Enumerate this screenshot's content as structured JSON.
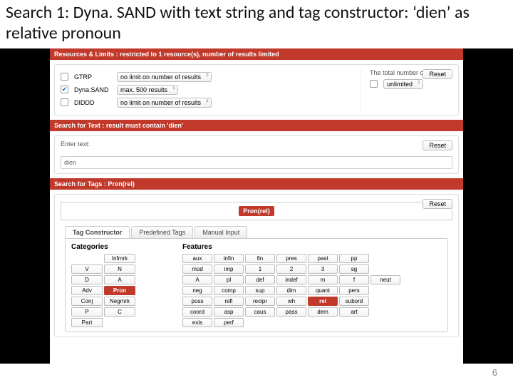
{
  "slide": {
    "title": "Search 1:  Dyna. SAND with text string and tag constructor: ‘dien’ as relative pronoun",
    "number": "6"
  },
  "resources": {
    "bar_label": "Resources & Limits : restricted to 1 resource(s), number of results limited",
    "items": [
      {
        "name": "GTRP",
        "checked": false,
        "limit": "no limit on number of results"
      },
      {
        "name": "Dyna.SAND",
        "checked": true,
        "limit": "max. 500 results"
      },
      {
        "name": "DIDDD",
        "checked": false,
        "limit": "no limit on number of results"
      }
    ],
    "total_label": "The total number of results is",
    "total_value": "unlimited",
    "reset": "Reset"
  },
  "text_search": {
    "bar_label": "Search for Text : result must contain 'dien'",
    "enter_label": "Enter text:",
    "value": "dien",
    "reset": "Reset"
  },
  "tag_search": {
    "bar_label": "Search for Tags : Pron(rel)",
    "chip": "Pron(rel)",
    "reset": "Reset"
  },
  "tabs": {
    "items": [
      "Tag Constructor",
      "Predefined Tags",
      "Manual Input"
    ]
  },
  "categories": {
    "head": "Categories",
    "grid": [
      [
        "",
        "Infmrk",
        ""
      ],
      [
        "V",
        "N",
        ""
      ],
      [
        "D",
        "A",
        ""
      ],
      [
        "Adv",
        "Pron",
        ""
      ],
      [
        "Conj",
        "Negmrk",
        ""
      ],
      [
        "P",
        "C",
        ""
      ],
      [
        "Part",
        "",
        ""
      ]
    ],
    "selected": "Pron"
  },
  "features": {
    "head": "Features",
    "grid": [
      [
        "aux",
        "infin",
        "fin",
        "pres",
        "past",
        "pp",
        ""
      ],
      [
        "mod",
        "imp",
        "1",
        "2",
        "3",
        "sg",
        ""
      ],
      [
        "A",
        "pl",
        "def",
        "indef",
        "m",
        "f",
        "neut"
      ],
      [
        "neg",
        "comp",
        "sup",
        "dim",
        "quant",
        "pers",
        ""
      ],
      [
        "poss",
        "refl",
        "recipr",
        "wh",
        "rel",
        "subord",
        ""
      ],
      [
        "coord",
        "asp",
        "caus",
        "pass",
        "dem",
        "art",
        ""
      ],
      [
        "exis",
        "perf",
        "",
        "",
        "",
        "",
        ""
      ]
    ],
    "selected": "rel"
  }
}
